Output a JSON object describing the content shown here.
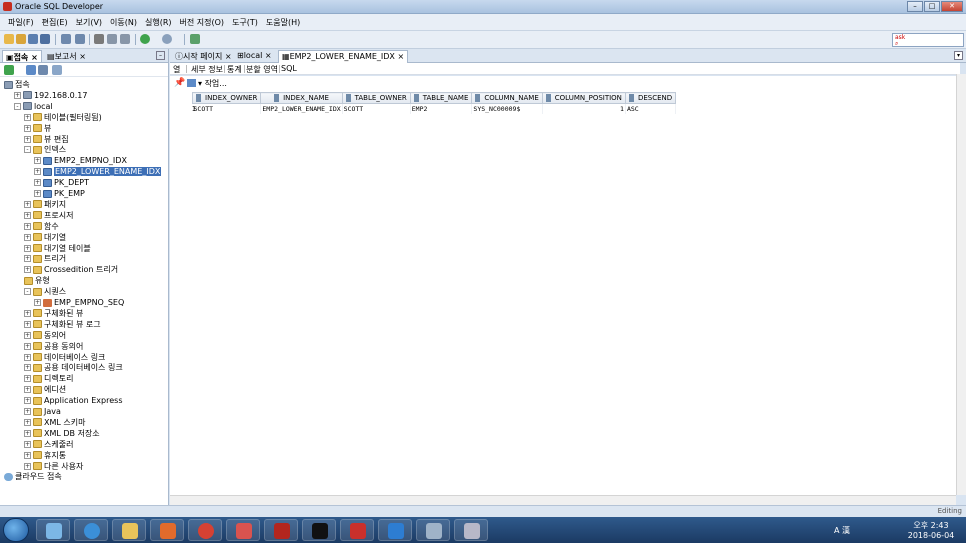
{
  "window": {
    "title": "Oracle SQL Developer"
  },
  "menu": [
    "파일(F)",
    "편집(E)",
    "보기(V)",
    "이동(N)",
    "실행(R)",
    "버전 지정(O)",
    "도구(T)",
    "도움말(H)"
  ],
  "left_tabs": {
    "connections": "접속",
    "reports": "보고서"
  },
  "tree": [
    {
      "label": "접속",
      "indent": 0,
      "icon": "connections-icon"
    },
    {
      "label": "192.168.0.17",
      "indent": 1,
      "exp": "+",
      "icon": "db"
    },
    {
      "label": "local",
      "indent": 1,
      "exp": "-",
      "icon": "db"
    },
    {
      "label": "테이블(필터링됨)",
      "indent": 2,
      "exp": "+",
      "icon": "folder"
    },
    {
      "label": "뷰",
      "indent": 2,
      "exp": "+",
      "icon": "folder"
    },
    {
      "label": "뷰 편집",
      "indent": 2,
      "exp": "+",
      "icon": "folder"
    },
    {
      "label": "인덱스",
      "indent": 2,
      "exp": "-",
      "icon": "folder"
    },
    {
      "label": "EMP2_EMPNO_IDX",
      "indent": 3,
      "exp": "+",
      "icon": "idx"
    },
    {
      "label": "EMP2_LOWER_ENAME_IDX",
      "indent": 3,
      "exp": "+",
      "icon": "idx",
      "selected": true
    },
    {
      "label": "PK_DEPT",
      "indent": 3,
      "exp": "+",
      "icon": "idx"
    },
    {
      "label": "PK_EMP",
      "indent": 3,
      "exp": "+",
      "icon": "idx"
    },
    {
      "label": "패키지",
      "indent": 2,
      "exp": "+",
      "icon": "folder"
    },
    {
      "label": "프로시저",
      "indent": 2,
      "exp": "+",
      "icon": "folder"
    },
    {
      "label": "함수",
      "indent": 2,
      "exp": "+",
      "icon": "folder"
    },
    {
      "label": "대기열",
      "indent": 2,
      "exp": "+",
      "icon": "folder"
    },
    {
      "label": "대기열 테이블",
      "indent": 2,
      "exp": "+",
      "icon": "folder"
    },
    {
      "label": "트리거",
      "indent": 2,
      "exp": "+",
      "icon": "folder"
    },
    {
      "label": "Crossedition 트리거",
      "indent": 2,
      "exp": "+",
      "icon": "folder"
    },
    {
      "label": "유형",
      "indent": 2,
      "exp": "",
      "icon": "folder"
    },
    {
      "label": "시퀀스",
      "indent": 2,
      "exp": "-",
      "icon": "folder"
    },
    {
      "label": "EMP_EMPNO_SEQ",
      "indent": 3,
      "exp": "+",
      "icon": "seq"
    },
    {
      "label": "구체화된 뷰",
      "indent": 2,
      "exp": "+",
      "icon": "folder"
    },
    {
      "label": "구체화된 뷰 로그",
      "indent": 2,
      "exp": "+",
      "icon": "folder"
    },
    {
      "label": "동의어",
      "indent": 2,
      "exp": "+",
      "icon": "folder"
    },
    {
      "label": "공용 동의어",
      "indent": 2,
      "exp": "+",
      "icon": "folder"
    },
    {
      "label": "데이터베이스 링크",
      "indent": 2,
      "exp": "+",
      "icon": "folder"
    },
    {
      "label": "공용 데이터베이스 링크",
      "indent": 2,
      "exp": "+",
      "icon": "folder"
    },
    {
      "label": "디렉토리",
      "indent": 2,
      "exp": "+",
      "icon": "folder"
    },
    {
      "label": "에디션",
      "indent": 2,
      "exp": "+",
      "icon": "folder"
    },
    {
      "label": "Application Express",
      "indent": 2,
      "exp": "+",
      "icon": "folder"
    },
    {
      "label": "Java",
      "indent": 2,
      "exp": "+",
      "icon": "folder"
    },
    {
      "label": "XML 스키마",
      "indent": 2,
      "exp": "+",
      "icon": "folder"
    },
    {
      "label": "XML DB 저장소",
      "indent": 2,
      "exp": "+",
      "icon": "folder"
    },
    {
      "label": "스케줄러",
      "indent": 2,
      "exp": "+",
      "icon": "folder"
    },
    {
      "label": "휴지통",
      "indent": 2,
      "exp": "+",
      "icon": "folder"
    },
    {
      "label": "다른 사용자",
      "indent": 2,
      "exp": "+",
      "icon": "folder"
    },
    {
      "label": "클라우드 접속",
      "indent": 0,
      "exp": "",
      "icon": "cloud"
    }
  ],
  "editor_tabs": {
    "start": "시작 페이지",
    "local": "local",
    "active": "EMP2_LOWER_ENAME_IDX"
  },
  "sub_tabs": {
    "columns": "열",
    "details": "세부 정보",
    "stats": "통계",
    "partitions": "분할 영역",
    "sql": "SQL"
  },
  "actions": {
    "actions_label": "작업..."
  },
  "grid": {
    "headers": [
      "INDEX_OWNER",
      "INDEX_NAME",
      "TABLE_OWNER",
      "TABLE_NAME",
      "COLUMN_NAME",
      "COLUMN_POSITION",
      "DESCEND"
    ],
    "rows": [
      {
        "num": "1",
        "cells": [
          "SCOTT",
          "EMP2_LOWER_ENAME_IDX",
          "SCOTT",
          "EMP2",
          "SYS_NC00009$",
          "1",
          "ASC"
        ]
      }
    ]
  },
  "status": {
    "mode": "Editing"
  },
  "taskbar": {
    "ime": "A 漢",
    "time": "오후 2:43",
    "date": "2018-06-04"
  }
}
